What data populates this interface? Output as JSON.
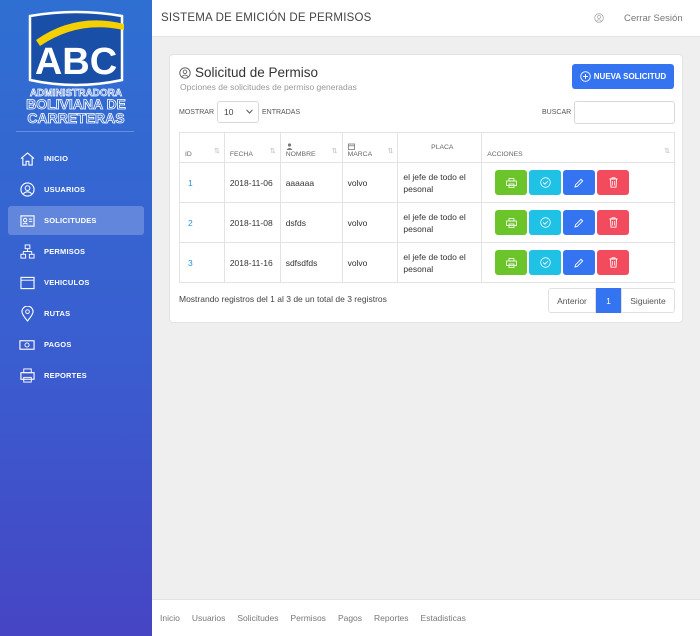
{
  "colors": {
    "sidebar_top": "#2f6fd2",
    "sidebar_bottom": "#4645c4",
    "primary": "#3474f0",
    "print_btn": "#6cc42b",
    "approve_btn": "#1fc1e5",
    "edit_btn": "#3474f0",
    "delete_btn": "#f24b5e",
    "id_link": "#2b8fd8"
  },
  "logo": {
    "acronym": "ABC",
    "line1": "ADMINISTRADORA",
    "line2": "BOLIVIANA DE",
    "line3": "CARRETERAS"
  },
  "sidebar": {
    "items": [
      {
        "label": "INICIO",
        "icon": "home-icon"
      },
      {
        "label": "USUARIOS",
        "icon": "user-circle-icon"
      },
      {
        "label": "SOLICITUDES",
        "icon": "id-card-icon",
        "active": true
      },
      {
        "label": "PERMISOS",
        "icon": "sitemap-icon"
      },
      {
        "label": "VEHICULOS",
        "icon": "window-icon"
      },
      {
        "label": "RUTAS",
        "icon": "map-pin-icon"
      },
      {
        "label": "PAGOS",
        "icon": "money-icon"
      },
      {
        "label": "REPORTES",
        "icon": "printer-icon"
      }
    ]
  },
  "header": {
    "title": "SISTEMA DE EMICIÓN DE PERMISOS",
    "logout": "Cerrar Sesión"
  },
  "card": {
    "title": "Solicitud de Permiso",
    "subtitle": "Opciones de solicitudes de permiso generadas",
    "new_button": "NUEVA SOLICITUD"
  },
  "table_controls": {
    "show_label": "MOSTRAR",
    "page_size": "10",
    "entries_label": "ENTRADAS",
    "search_label": "BUSCAR",
    "search_value": ""
  },
  "table": {
    "headers": {
      "id": "ID",
      "fecha": "FECHA",
      "nombre": "NOMBRE",
      "marca": "MARCA",
      "placa": "PLACA",
      "acciones": "ACCIONES"
    },
    "rows": [
      {
        "id": "1",
        "fecha": "2018-11-06",
        "nombre": "aaaaaa",
        "marca": "volvo",
        "placa": "el jefe de todo el pesonal"
      },
      {
        "id": "2",
        "fecha": "2018-11-08",
        "nombre": "dsfds",
        "marca": "volvo",
        "placa": "el jefe de todo el pesonal"
      },
      {
        "id": "3",
        "fecha": "2018-11-16",
        "nombre": "sdfsdfds",
        "marca": "volvo",
        "placa": "el jefe de todo el pesonal"
      }
    ]
  },
  "pagination": {
    "info": "Mostrando registros del 1 al 3 de un total de 3 registros",
    "prev": "Anterior",
    "current": "1",
    "next": "Siguiente"
  },
  "footer": {
    "links": [
      "Inicio",
      "Usuarios",
      "Solicitudes",
      "Permisos",
      "Pagos",
      "Reportes",
      "Estadisticas"
    ]
  }
}
